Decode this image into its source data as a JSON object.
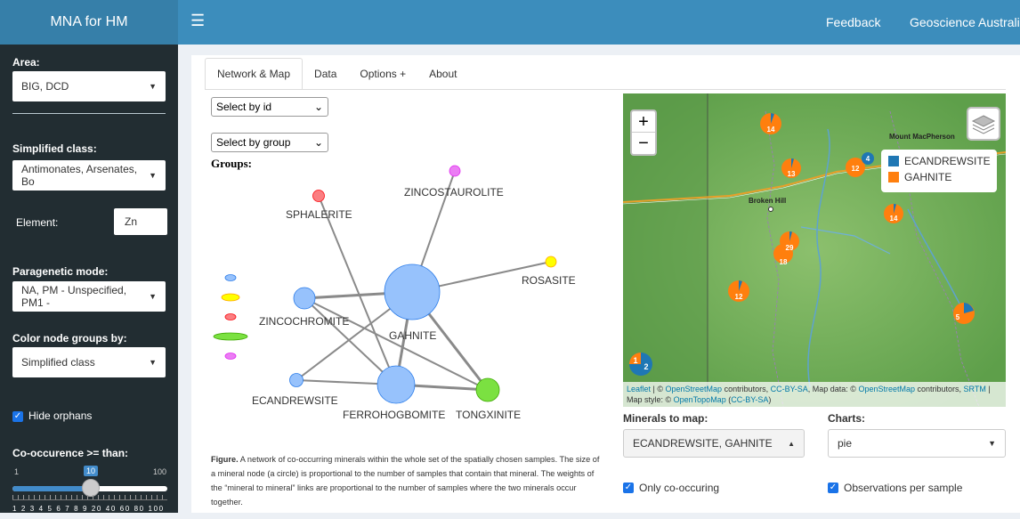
{
  "header": {
    "app_title": "MNA for HM",
    "menu_icon": "hamburger-icon",
    "feedback": "Feedback",
    "org": "Geoscience Australia"
  },
  "sidebar": {
    "area_label": "Area:",
    "area_value": "BIG, DCD",
    "simplified_class_label": "Simplified class:",
    "simplified_class_value": "Antimonates, Arsenates, Bo",
    "element_label": "Element:",
    "element_value": "Zn",
    "paragenetic_label": "Paragenetic mode:",
    "paragenetic_value": "NA, PM - Unspecified, PM1 -",
    "color_by_label": "Color node groups by:",
    "color_by_value": "Simplified class",
    "hide_orphans_label": "Hide orphans",
    "hide_orphans_checked": true,
    "cooccurrence_label": "Co-occurence >= than:",
    "slider": {
      "min": "1",
      "max": "100",
      "value": "10",
      "value_fraction": 0.1,
      "tick_labels": "1 2 3 4 5 6 7 8 9   20  40  60  80 100"
    }
  },
  "tabs": [
    {
      "label": "Network & Map",
      "active": true
    },
    {
      "label": "Data",
      "active": false
    },
    {
      "label": "Options +",
      "active": false
    },
    {
      "label": "About",
      "active": false
    }
  ],
  "network": {
    "select_id": "Select by id",
    "select_group": "Select by group",
    "groups_label": "Groups:",
    "group_colors": [
      "#97c2fc",
      "#ffff00",
      "#fb7e81",
      "#7be141",
      "#eb7df4"
    ],
    "nodes": [
      {
        "id": "ZINCOSTAUROLITE",
        "color": "#eb7df4"
      },
      {
        "id": "SPHALERITE",
        "color": "#fb7e81"
      },
      {
        "id": "ROSASITE",
        "color": "#ffff00"
      },
      {
        "id": "ZINCOCHROMITE",
        "color": "#97c2fc"
      },
      {
        "id": "GAHNITE",
        "color": "#97c2fc"
      },
      {
        "id": "ECANDREWSITE",
        "color": "#97c2fc"
      },
      {
        "id": "FERROHOGBOMITE",
        "color": "#97c2fc"
      },
      {
        "id": "TONGXINITE",
        "color": "#7be141"
      }
    ],
    "figure_caption_bold": "Figure.",
    "figure_caption": "A network of co-occurring minerals within the whole set of the spatially chosen samples. The size of a mineral node (a circle) is proportional to the number of samples that contain that mineral. The weights of the “mineral to mineral” links are proportional to the number of samples where the two minerals occur together."
  },
  "map": {
    "zoom_in": "+",
    "zoom_out": "−",
    "places": [
      "Mount MacPherson",
      "Broken Hill"
    ],
    "legend": [
      {
        "label": "ECANDREWSITE",
        "color": "#1f77b4"
      },
      {
        "label": "GAHNITE",
        "color": "#ff7f0e"
      }
    ],
    "pies": [
      "14",
      "13",
      "12",
      "4",
      "14",
      "29",
      "18",
      "12",
      "5",
      "1",
      "2"
    ],
    "attribution": {
      "leaflet": "Leaflet",
      "sep1": " | © ",
      "osm": "OpenStreetMap",
      "t1": " contributors, ",
      "ccbysa": "CC-BY-SA",
      "t2": ", Map data: © ",
      "osm2": "OpenStreetMap",
      "t3": " contributors, ",
      "srtm": "SRTM",
      "t4": " | Map style: © ",
      "otm": "OpenTopoMap",
      "t5": " (",
      "cc2": "CC-BY-SA",
      "t6": ")"
    }
  },
  "controls": {
    "minerals_label": "Minerals to map:",
    "minerals_value": "ECANDREWSITE, GAHNITE",
    "charts_label": "Charts:",
    "charts_value": "pie",
    "only_cooccurring": "Only co-occuring",
    "obs_per_sample": "Observations per sample"
  }
}
